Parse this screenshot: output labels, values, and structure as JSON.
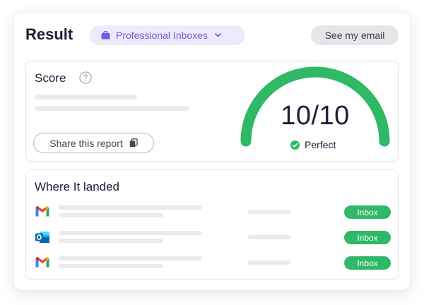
{
  "header": {
    "title": "Result",
    "inbox_selector": "Professional Inboxes",
    "see_email_label": "See my email"
  },
  "score": {
    "title": "Score",
    "share_label": "Share this report",
    "value": "10/10",
    "fill_fraction": 1.0,
    "status": "Perfect",
    "status_color": "#2fb865"
  },
  "landed": {
    "title": "Where It landed",
    "rows": [
      {
        "provider_icon": "gmail-icon",
        "placement": "Inbox"
      },
      {
        "provider_icon": "outlook-icon",
        "placement": "Inbox"
      },
      {
        "provider_icon": "gmail-icon",
        "placement": "Inbox"
      }
    ]
  },
  "colors": {
    "accent": "#6c5ce7",
    "accent_bg": "#ecebfd",
    "success": "#2fb865"
  }
}
